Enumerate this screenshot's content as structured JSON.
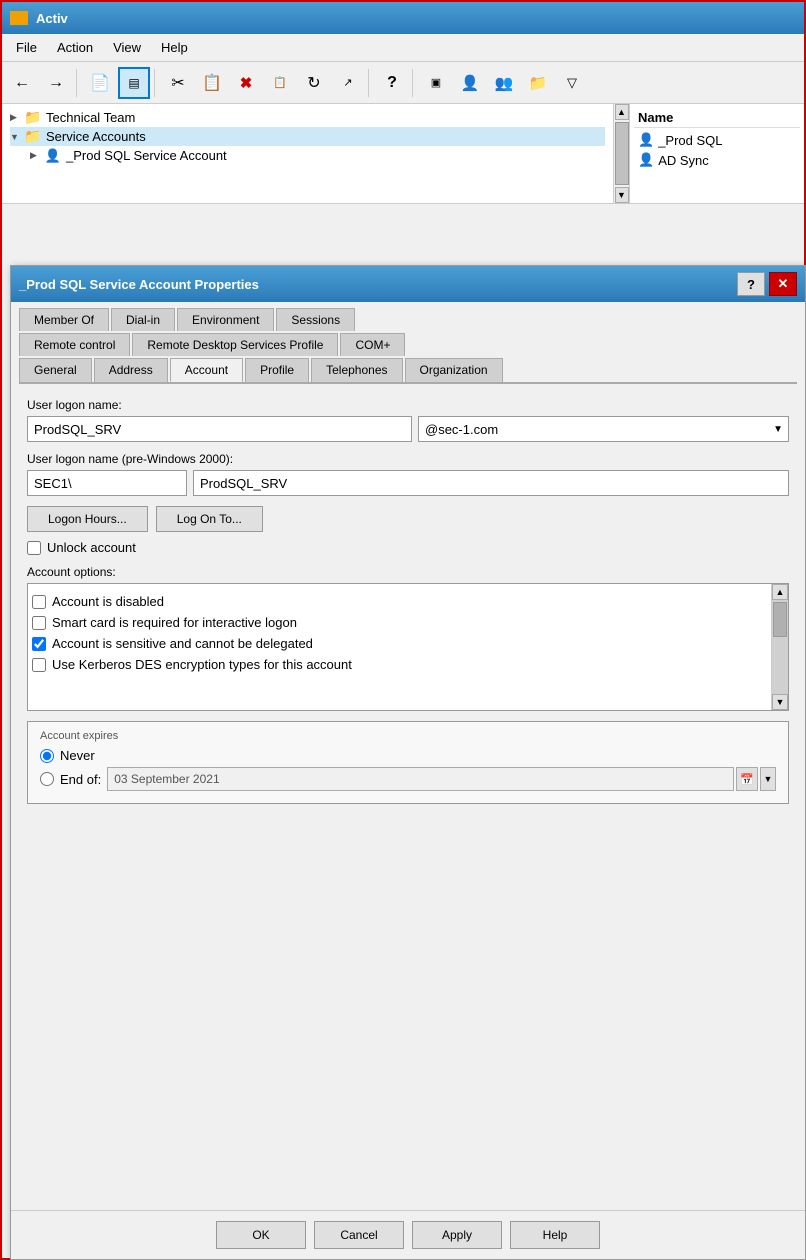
{
  "window": {
    "title": "Activ",
    "icon": "□"
  },
  "menu": {
    "items": [
      "File",
      "Action",
      "View",
      "Help"
    ]
  },
  "toolbar": {
    "buttons": [
      {
        "name": "back",
        "icon": "←",
        "active": false
      },
      {
        "name": "forward",
        "icon": "→",
        "active": false
      },
      {
        "name": "up",
        "icon": "📄",
        "active": false
      },
      {
        "name": "show-console",
        "icon": "▤",
        "active": true
      },
      {
        "name": "cut",
        "icon": "✂",
        "active": false
      },
      {
        "name": "copy",
        "icon": "📋",
        "active": false
      },
      {
        "name": "delete",
        "icon": "✖",
        "active": false,
        "color": "red"
      },
      {
        "name": "properties",
        "icon": "📋",
        "active": false
      },
      {
        "name": "refresh",
        "icon": "↺",
        "active": false
      },
      {
        "name": "export",
        "icon": "📤",
        "active": false
      },
      {
        "name": "help",
        "icon": "?",
        "active": false
      },
      {
        "name": "view1",
        "icon": "▣",
        "active": false
      },
      {
        "name": "users",
        "icon": "👤",
        "active": false
      },
      {
        "name": "group",
        "icon": "👥",
        "active": false
      },
      {
        "name": "folder",
        "icon": "📁",
        "active": false
      },
      {
        "name": "filter",
        "icon": "▽",
        "active": false
      }
    ]
  },
  "tree": {
    "items": [
      {
        "label": "Technical Team",
        "indent": 1,
        "type": "folder",
        "expanded": false
      },
      {
        "label": "Service Accounts",
        "indent": 1,
        "type": "folder",
        "expanded": true
      },
      {
        "label": "_Prod SQL Service Account",
        "indent": 2,
        "type": "user"
      }
    ],
    "right_panel": {
      "header": "Name",
      "items": [
        {
          "label": "_Prod SQL",
          "type": "user"
        },
        {
          "label": "AD Sync",
          "type": "user"
        }
      ]
    }
  },
  "dialog": {
    "title": "_Prod SQL Service Account Properties",
    "tabs_row1": [
      "Member Of",
      "Dial-in",
      "Environment",
      "Sessions"
    ],
    "tabs_row2": [
      "Remote control",
      "Remote Desktop Services Profile",
      "COM+"
    ],
    "tabs_row3": [
      "General",
      "Address",
      "Account",
      "Profile",
      "Telephones",
      "Organization"
    ],
    "active_tab": "Account",
    "fields": {
      "user_logon_label": "User logon name:",
      "user_logon_name": "ProdSQL_SRV",
      "domain_options": [
        "@sec-1.com",
        "@sec-1.com"
      ],
      "domain_selected": "@sec-1.com",
      "pre_win2000_label": "User logon name (pre-Windows 2000):",
      "pre_win2000_domain": "SEC1\\",
      "pre_win2000_name": "ProdSQL_SRV",
      "logon_hours_btn": "Logon Hours...",
      "log_on_to_btn": "Log On To...",
      "unlock_account_label": "Unlock account",
      "unlock_account_checked": false,
      "account_options_label": "Account options:",
      "account_options": [
        {
          "label": "Account is disabled",
          "checked": false
        },
        {
          "label": "Smart card is required for interactive logon",
          "checked": false
        },
        {
          "label": "Account is sensitive and cannot be delegated",
          "checked": true
        },
        {
          "label": "Use Kerberos DES encryption types for this account",
          "checked": false
        }
      ],
      "account_expires_label": "Account expires",
      "never_label": "Never",
      "never_checked": true,
      "end_of_label": "End of:",
      "end_of_date": "03 September 2021",
      "end_of_checked": false
    },
    "bottom_buttons": [
      "OK",
      "Cancel",
      "Apply",
      "Help"
    ]
  }
}
